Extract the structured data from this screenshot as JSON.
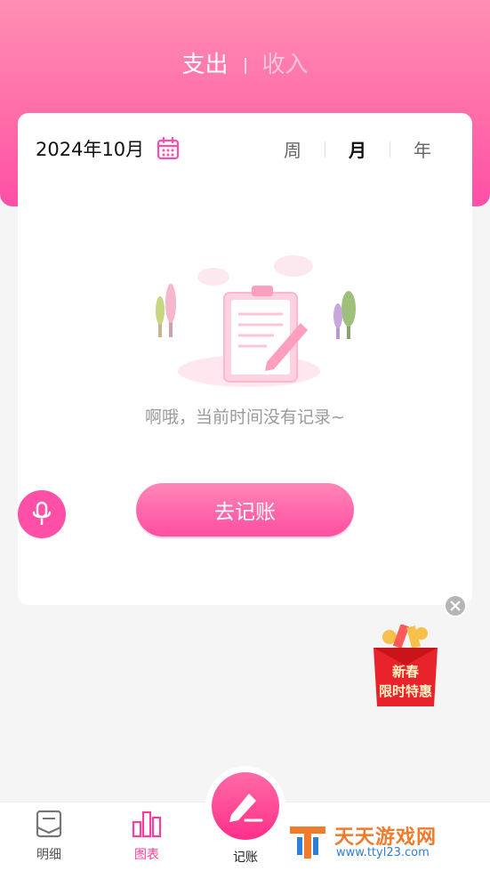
{
  "header": {
    "type_active": "支出",
    "type_inactive": "收入"
  },
  "card": {
    "date": "2024年10月",
    "periods": [
      "周",
      "月",
      "年"
    ],
    "period_selected": "月",
    "empty_message": "啊哦，当前时间没有记录~",
    "go_button": "去记账"
  },
  "promo": {
    "line1": "新春",
    "line2": "限时特惠"
  },
  "bottom_nav": {
    "detail": "明细",
    "chart": "图表",
    "add": "记账"
  },
  "watermark": {
    "name": "天天游戏网",
    "url": "www.ttyl23.com"
  },
  "colors": {
    "accent": "#ff4fa7",
    "header_top": "#ff8fb3"
  }
}
